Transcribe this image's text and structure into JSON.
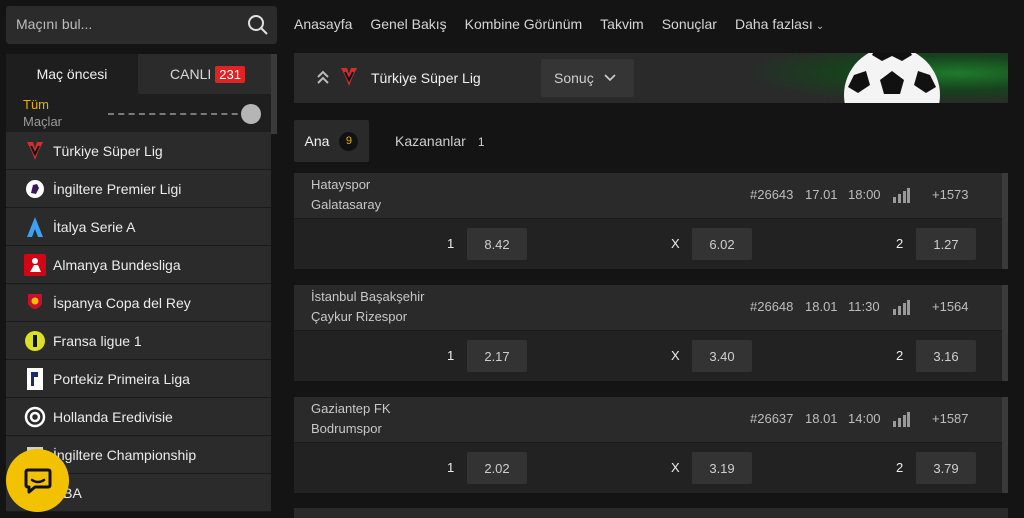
{
  "search": {
    "placeholder": "Maçını bul..."
  },
  "sidebar": {
    "tab_prematch": "Maç öncesi",
    "tab_live": "CANLI",
    "live_count": "231",
    "filter_line1": "Tüm",
    "filter_line2": "Maçlar",
    "leagues": [
      {
        "label": "Türkiye Süper Lig",
        "icon": "super-lig-logo-icon"
      },
      {
        "label": "İngiltere Premier Ligi",
        "icon": "premier-league-logo-icon"
      },
      {
        "label": "İtalya Serie A",
        "icon": "serie-a-logo-icon"
      },
      {
        "label": "Almanya Bundesliga",
        "icon": "bundesliga-logo-icon"
      },
      {
        "label": "İspanya Copa del Rey",
        "icon": "copa-del-rey-logo-icon"
      },
      {
        "label": "Fransa ligue 1",
        "icon": "ligue-1-logo-icon"
      },
      {
        "label": "Portekiz Primeira Liga",
        "icon": "primeira-liga-logo-icon"
      },
      {
        "label": "Hollanda Eredivisie",
        "icon": "eredivisie-logo-icon"
      },
      {
        "label": "İngiltere Championship",
        "icon": "championship-logo-icon"
      },
      {
        "label": "NBA",
        "icon": "nba-logo-icon"
      }
    ]
  },
  "nav": {
    "items": [
      "Anasayfa",
      "Genel Bakış",
      "Kombine Görünüm",
      "Takvim",
      "Sonuçlar"
    ],
    "more": "Daha fazlası"
  },
  "banner": {
    "title": "Türkiye Süper Lig",
    "select_value": "Sonuç"
  },
  "subtabs": {
    "ana_label": "Ana",
    "ana_count": "9",
    "kazananlar_label": "Kazananlar",
    "kazananlar_count": "1"
  },
  "matches": [
    {
      "home": "Hatayspor",
      "away": "Galatasaray",
      "id": "#26643",
      "date": "17.01",
      "time": "18:00",
      "more": "+1573",
      "odds": [
        {
          "label": "1",
          "value": "8.42"
        },
        {
          "label": "X",
          "value": "6.02"
        },
        {
          "label": "2",
          "value": "1.27"
        }
      ]
    },
    {
      "home": "İstanbul Başakşehir",
      "away": "Çaykur Rizespor",
      "id": "#26648",
      "date": "18.01",
      "time": "11:30",
      "more": "+1564",
      "odds": [
        {
          "label": "1",
          "value": "2.17"
        },
        {
          "label": "X",
          "value": "3.40"
        },
        {
          "label": "2",
          "value": "3.16"
        }
      ]
    },
    {
      "home": "Gaziantep FK",
      "away": "Bodrumspor",
      "id": "#26637",
      "date": "18.01",
      "time": "14:00",
      "more": "+1587",
      "odds": [
        {
          "label": "1",
          "value": "2.02"
        },
        {
          "label": "X",
          "value": "3.19"
        },
        {
          "label": "2",
          "value": "3.79"
        }
      ]
    }
  ],
  "colors": {
    "accent": "#e8b100",
    "live_badge": "#e02424",
    "chat_button": "#f2c200"
  }
}
